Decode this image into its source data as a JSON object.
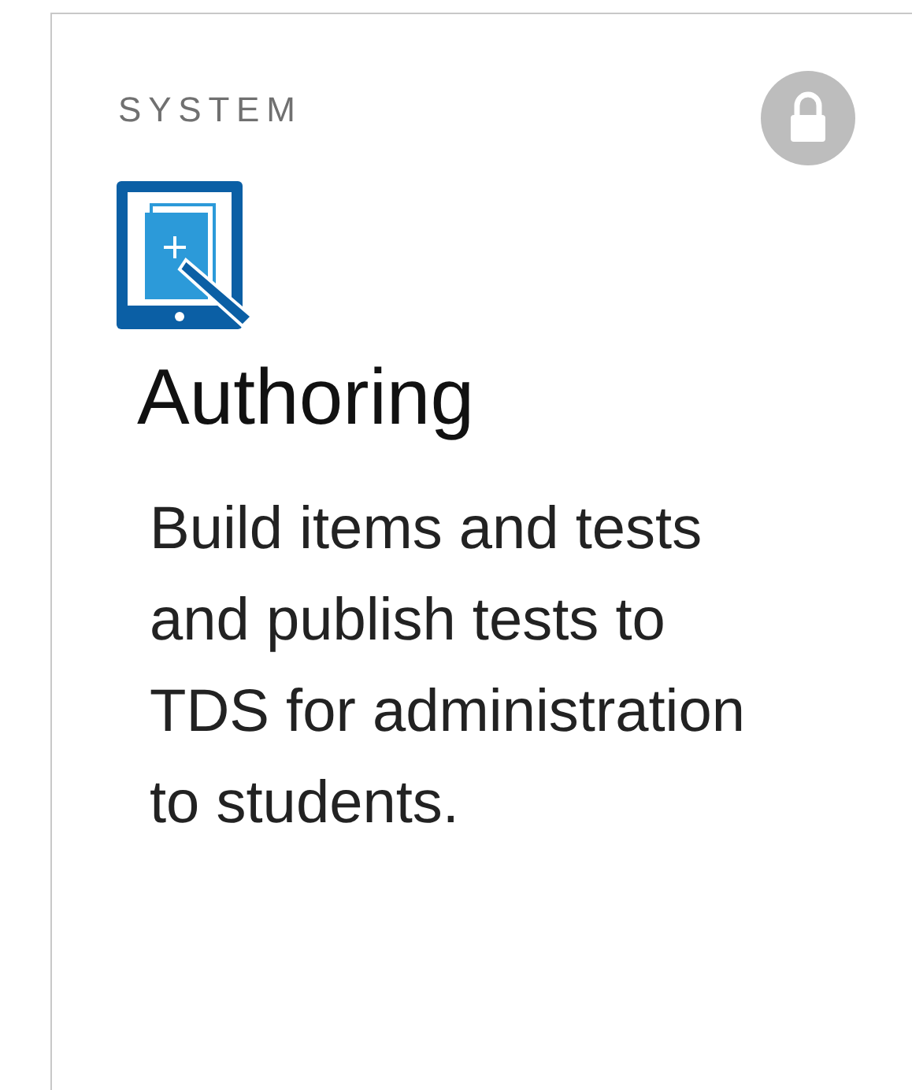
{
  "card": {
    "category": "SYSTEM",
    "locked": true,
    "title": "Authoring",
    "description": "Build items and tests and publish tests to TDS for administration to students."
  }
}
